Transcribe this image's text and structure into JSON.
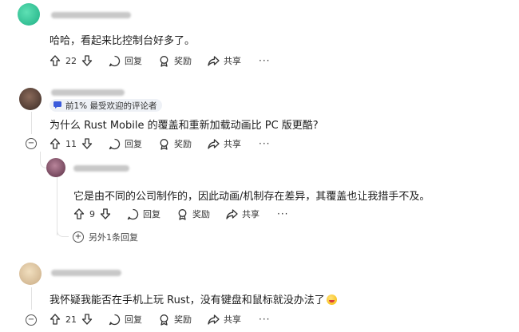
{
  "comments": [
    {
      "text": "哈哈，看起来比控制台好多了。",
      "votes": "22",
      "reply_label": "回复",
      "award_label": "奖励",
      "share_label": "共享",
      "more_label": "···"
    },
    {
      "badge": "前1% 最受欢迎的评论者",
      "text": "为什么 Rust Mobile 的覆盖和重新加载动画比 PC 版更酷?",
      "votes": "11",
      "collapse_label": "−",
      "reply_label": "回复",
      "award_label": "奖励",
      "share_label": "共享",
      "more_label": "···"
    },
    {
      "text": "它是由不同的公司制作的，因此动画/机制存在差异，其覆盖也让我措手不及。",
      "votes": "9",
      "reply_label": "回复",
      "award_label": "奖励",
      "share_label": "共享",
      "more_label": "···",
      "more_replies_label": "另外1条回复"
    },
    {
      "text": "我怀疑我能否在手机上玩 Rust，没有键盘和鼠标就没办法了",
      "votes": "21",
      "collapse_label": "−",
      "reply_label": "回复",
      "award_label": "奖励",
      "share_label": "共享",
      "more_label": "···"
    }
  ]
}
